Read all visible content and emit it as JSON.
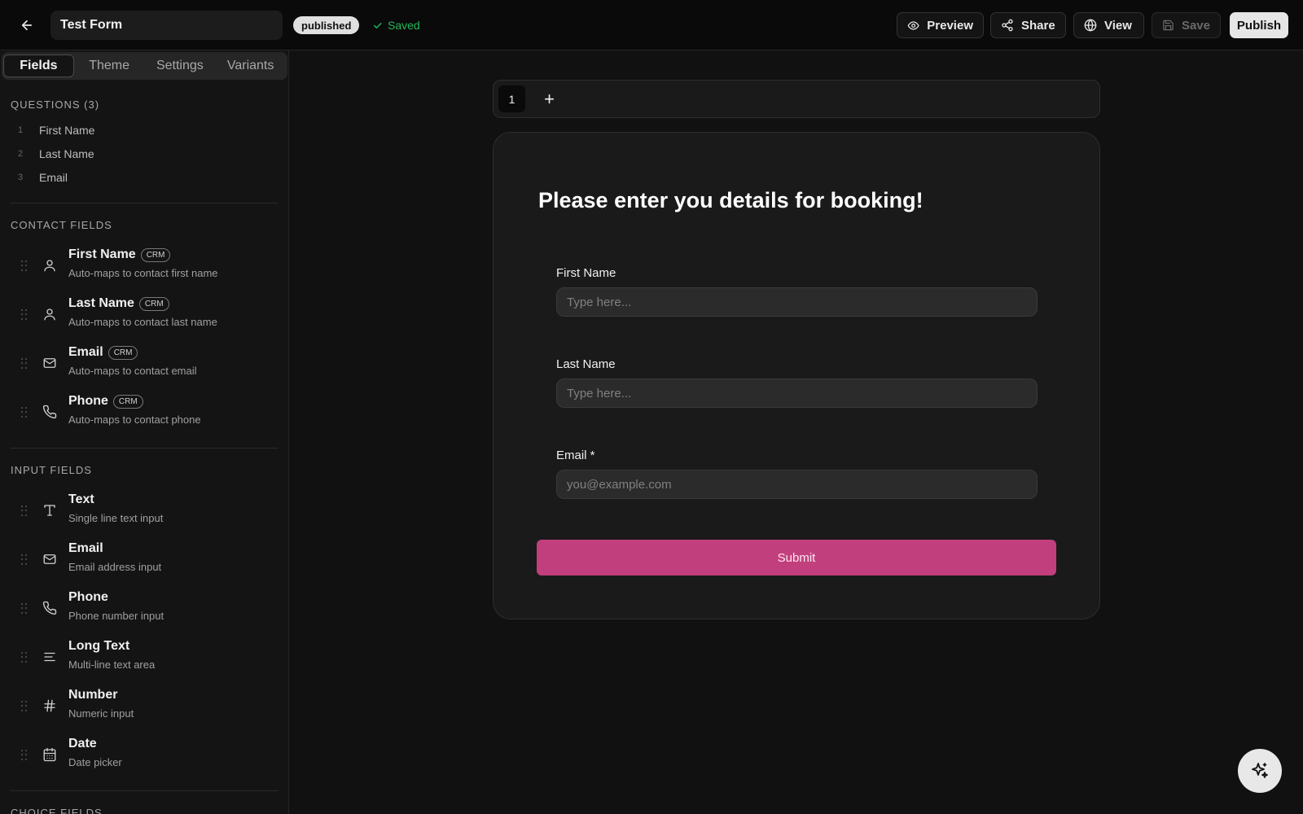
{
  "header": {
    "form_title": "Test Form",
    "status": "published",
    "saved_label": "Saved",
    "buttons": {
      "preview": "Preview",
      "share": "Share",
      "view": "View",
      "save": "Save",
      "publish": "Publish"
    }
  },
  "sidebar": {
    "tabs": [
      {
        "label": "Fields",
        "active": true
      },
      {
        "label": "Theme",
        "active": false
      },
      {
        "label": "Settings",
        "active": false
      },
      {
        "label": "Variants",
        "active": false
      }
    ],
    "questions_header": "QUESTIONS (3)",
    "questions": [
      {
        "num": "1",
        "label": "First Name"
      },
      {
        "num": "2",
        "label": "Last Name"
      },
      {
        "num": "3",
        "label": "Email"
      }
    ],
    "contact_header": "CONTACT FIELDS",
    "contact_fields": [
      {
        "icon": "user-icon",
        "title": "First Name",
        "badge": "CRM",
        "desc": "Auto-maps to contact first name"
      },
      {
        "icon": "user-icon",
        "title": "Last Name",
        "badge": "CRM",
        "desc": "Auto-maps to contact last name"
      },
      {
        "icon": "mail-icon",
        "title": "Email",
        "badge": "CRM",
        "desc": "Auto-maps to contact email"
      },
      {
        "icon": "phone-icon",
        "title": "Phone",
        "badge": "CRM",
        "desc": "Auto-maps to contact phone"
      }
    ],
    "input_header": "INPUT FIELDS",
    "input_fields": [
      {
        "icon": "text-icon",
        "title": "Text",
        "desc": "Single line text input"
      },
      {
        "icon": "mail-icon",
        "title": "Email",
        "desc": "Email address input"
      },
      {
        "icon": "phone-icon",
        "title": "Phone",
        "desc": "Phone number input"
      },
      {
        "icon": "long-text-icon",
        "title": "Long Text",
        "desc": "Multi-line text area"
      },
      {
        "icon": "hash-icon",
        "title": "Number",
        "desc": "Numeric input"
      },
      {
        "icon": "calendar-icon",
        "title": "Date",
        "desc": "Date picker"
      }
    ],
    "choice_header": "CHOICE FIELDS"
  },
  "canvas": {
    "page_number": "1",
    "add_page_glyph": "+",
    "form": {
      "heading": "Please enter you details for booking!",
      "fields": [
        {
          "label": "First Name",
          "placeholder": "Type here..."
        },
        {
          "label": "Last Name",
          "placeholder": "Type here..."
        },
        {
          "label": "Email *",
          "placeholder": "you@example.com"
        }
      ],
      "submit_label": "Submit",
      "submit_color": "#c23f7d"
    }
  },
  "colors": {
    "accent": "#c23f7d",
    "saved": "#22b85a",
    "background": "#111111"
  }
}
